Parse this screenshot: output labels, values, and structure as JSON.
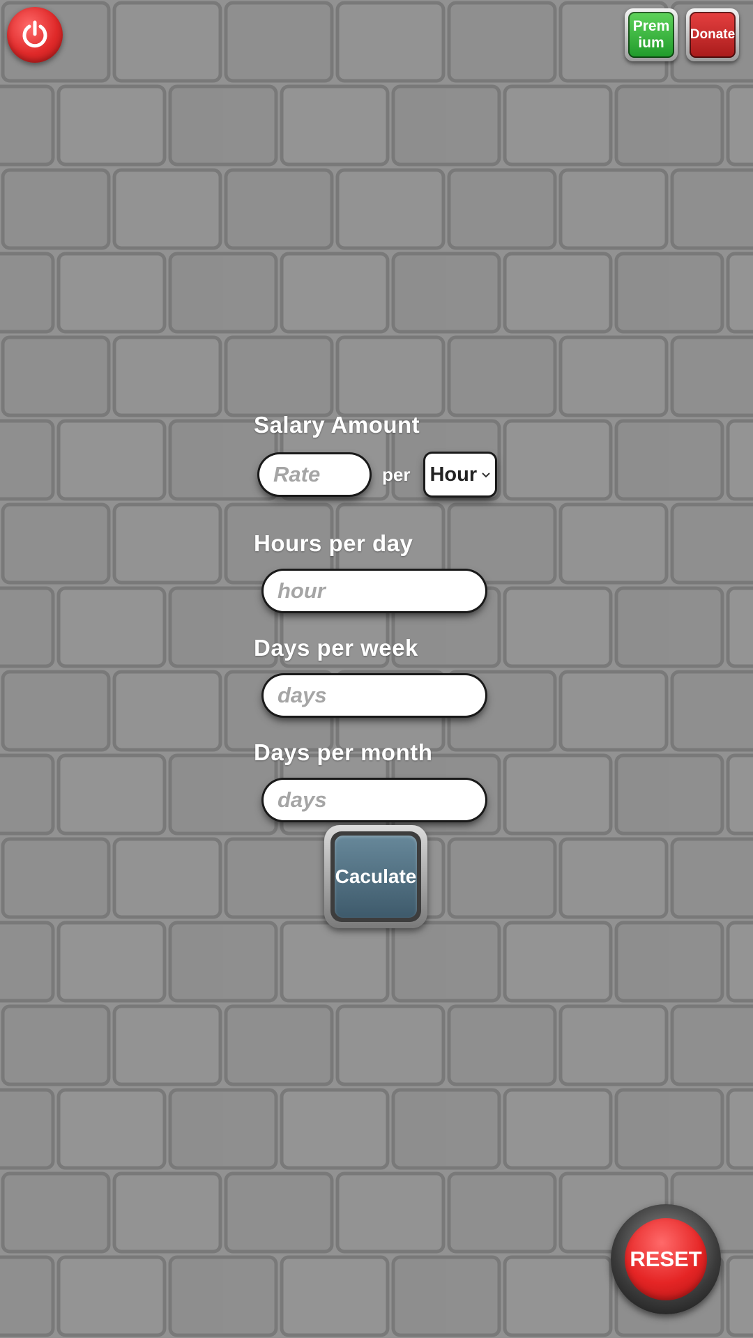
{
  "header": {
    "power_icon": "power-icon",
    "premium_label": "Premium",
    "donate_label": "Donate"
  },
  "form": {
    "salary_label": "Salary Amount",
    "rate_placeholder": "Rate",
    "per_label": "per",
    "unit_selected": "Hour",
    "hours_label": "Hours per day",
    "hours_placeholder": "hour",
    "days_week_label": "Days per week",
    "days_week_placeholder": "days",
    "days_month_label": "Days per month",
    "days_month_placeholder": "days"
  },
  "actions": {
    "calculate_label": "Caculate",
    "reset_label": "RESET"
  },
  "colors": {
    "power": "#e02a2a",
    "premium": "#2fae35",
    "donate": "#c02323",
    "calculate": "#4f6f80",
    "reset": "#e52525",
    "background": "#8f8f8f"
  }
}
